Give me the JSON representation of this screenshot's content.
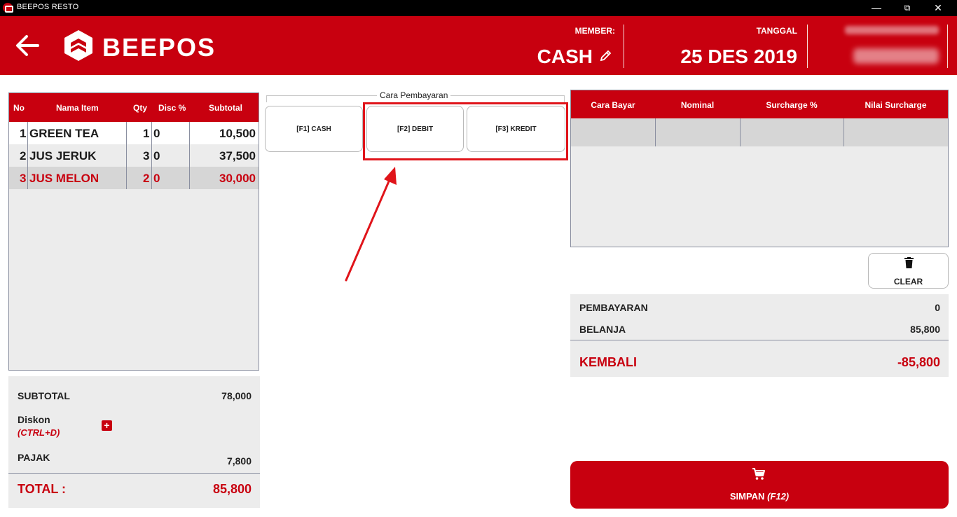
{
  "window": {
    "title": "BEEPOS RESTO",
    "controls": {
      "minimize": "—",
      "maximize": "⧉",
      "close": "✕"
    }
  },
  "header": {
    "logo_text": "BEEPOS",
    "member_label": "MEMBER:",
    "member_value": "CASH",
    "date_label": "TANGGAL",
    "date_value": "25 DES 2019",
    "colors": {
      "brand": "#c8000f"
    }
  },
  "order_table": {
    "columns": [
      "No",
      "Nama Item",
      "Qty",
      "Disc %",
      "Subtotal"
    ],
    "rows": [
      {
        "no": "1",
        "item": "GREEN TEA",
        "qty": "1",
        "disc": "0",
        "subtotal": "10,500"
      },
      {
        "no": "2",
        "item": "JUS JERUK",
        "qty": "3",
        "disc": "0",
        "subtotal": "37,500"
      },
      {
        "no": "3",
        "item": "JUS MELON",
        "qty": "2",
        "disc": "0",
        "subtotal": "30,000"
      }
    ]
  },
  "summary": {
    "subtotal_label": "SUBTOTAL",
    "subtotal_value": "78,000",
    "diskon_label": "Diskon",
    "diskon_hint": "(CTRL+D)",
    "add_symbol": "+",
    "pajak_label": "PAJAK",
    "pajak_value": "7,800",
    "total_label": "TOTAL :",
    "total_value": "85,800"
  },
  "payment_methods": {
    "group_label": "Cara Pembayaran",
    "buttons": [
      "[F1] CASH",
      "[F2] DEBIT",
      "[F3] KREDIT"
    ]
  },
  "payment_table": {
    "columns": [
      "Cara Bayar",
      "Nominal",
      "Surcharge %",
      "Nilai Surcharge"
    ]
  },
  "clear_button": {
    "label": "CLEAR"
  },
  "payment_summary": {
    "pembayaran_label": "PEMBAYARAN",
    "pembayaran_value": "0",
    "belanja_label": "BELANJA",
    "belanja_value": "85,800",
    "kembali_label": "KEMBALI",
    "kembali_value": "-85,800"
  },
  "save_button": {
    "label": "SIMPAN",
    "shortcut": "(F12)"
  },
  "icons": [
    "back-arrow-icon",
    "beepos-logo-icon",
    "edit-pencil-icon",
    "trash-icon",
    "cart-icon",
    "plus-icon"
  ]
}
